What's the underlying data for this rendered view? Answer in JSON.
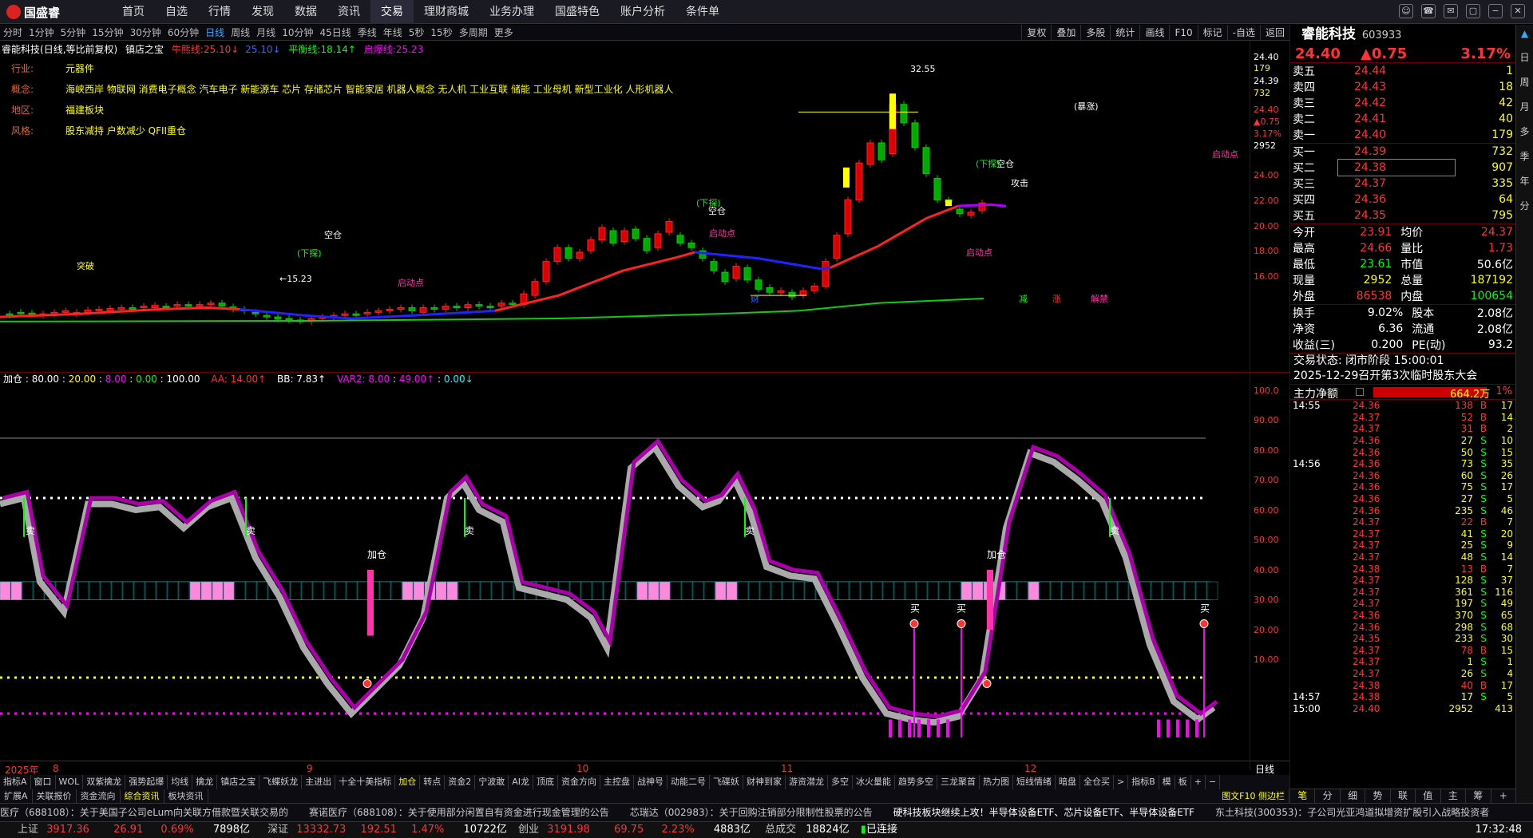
{
  "app": {
    "logo": "国盛睿"
  },
  "nav": [
    "首页",
    "自选",
    "行情",
    "发现",
    "数据",
    "资讯",
    "交易",
    "理财商城",
    "业务办理",
    "国盛特色",
    "账户分析",
    "条件单"
  ],
  "nav_active": 6,
  "window_buttons": [
    "☺",
    "☎",
    "✉",
    "▢",
    "−",
    "✕"
  ],
  "periods": [
    "分时",
    "1分钟",
    "5分钟",
    "15分钟",
    "30分钟",
    "60分钟",
    "日线",
    "周线",
    "月线",
    "10分钟",
    "45日线",
    "季线",
    "年线",
    "5秒",
    "15秒",
    "多周期",
    "更多"
  ],
  "period_active": 6,
  "tools": [
    "复权",
    "叠加",
    "多股",
    "统计",
    "画线",
    "F10",
    "标记",
    "-自选",
    "返回"
  ],
  "stock": {
    "name": "睿能科技",
    "mode": "(日线,等比前复权)",
    "indicator": "镇店之宝",
    "l1_label": "牛熊线:",
    "l1": "25.10",
    "l2": "25.10",
    "l3_label": "平衡线:",
    "l3": "18.14",
    "l4_label": "启爆线:",
    "l4": "25.23",
    "code": "603933"
  },
  "info": [
    {
      "k": "行业:",
      "v": "元器件"
    },
    {
      "k": "概念:",
      "v": "海峡西岸 物联网 消费电子概念 汽车电子 新能源车 芯片 存储芯片 智能家居 机器人概念 无人机 工业互联 储能 工业母机 新型工业化 人形机器人"
    },
    {
      "k": "地区:",
      "v": "福建板块"
    },
    {
      "k": "风格:",
      "v": "股东减持 户数减少 QFII重仓"
    }
  ],
  "price_scale": [
    "24.40",
    "179",
    "24.39",
    "732",
    "24.40",
    "▲0.75",
    "3.17%",
    "2952",
    "24.00",
    "22.00",
    "20.00",
    "18.00",
    "16.00"
  ],
  "ind_scale": [
    "100.0",
    "90.00",
    "80.00",
    "70.00",
    "60.00",
    "50.00",
    "40.00",
    "30.00",
    "20.00",
    "10.00"
  ],
  "ind_header": {
    "name": "加仓",
    "v1": "80.00",
    "v2": "20.00",
    "v3": "8.00",
    "v4": "0.00",
    "v5": "100.00",
    "aa": "AA: 14.00↑",
    "bb": "BB: 7.83↑",
    "var2": "VAR2: 8.00",
    "v6": "49.00↑",
    "v7": "0.00↓"
  },
  "dates": [
    "2025年",
    "8",
    "9",
    "10",
    "11",
    "12"
  ],
  "date_right": "日线",
  "chart_marks": {
    "high": "32.55",
    "low": "15.23",
    "kongcang1": "空仓",
    "kongcang2": "空仓",
    "kongcang3": "空仓",
    "xiati1": "(下探)",
    "xiati2": "(下探)",
    "xiati3": "(下探)",
    "qidong1": "启动点",
    "qidong2": "启动点",
    "qidong3": "启动点",
    "qidong4": "启动点",
    "tupo": "突破",
    "tuzhang": "(暴涨)",
    "jingong": "攻击",
    "cai": "财",
    "jian": "减",
    "zhang": "涨",
    "jiedong": "解禁",
    "jiacang1": "加仓",
    "jiacang2": "加仓",
    "mai1": "卖",
    "mai2": "卖",
    "mai3": "卖",
    "mai4": "卖",
    "mai5": "卖",
    "buy1": "买",
    "buy2": "买",
    "buy3": "买"
  },
  "tabs1": [
    "指标A",
    "窗口",
    "WOL",
    "双紫擒龙",
    "强势起爆",
    "均线",
    "擒龙",
    "镇店之宝",
    "飞蝶妖龙",
    "主进出",
    "十全十美指标",
    "加仓",
    "转点",
    "资金2",
    "宁波敢",
    "AI龙",
    "顶底",
    "资金方向",
    "主控盘",
    "战神号",
    "动能二号",
    "飞碟妖",
    "财神到家",
    "游资潜龙",
    "多空",
    "冰火量能",
    "趋势多空",
    "三龙聚首",
    "热力图",
    "短线情绪",
    "暗盘",
    "全仓买",
    ">",
    "指标B",
    "模",
    "板",
    "+",
    "−"
  ],
  "tabs1_active": 11,
  "tabs2": [
    "扩展A",
    "关联报价",
    "资金流向",
    "综合资讯",
    "板块资讯"
  ],
  "tabs2_active": 3,
  "tabs2_right": "图文F10 侧边栏",
  "news": [
    "医疗（688108）：关于美国子公司eLum向关联方借款暨关联交易的",
    "赛诺医疗（688108）：关于使用部分闲置自有资金进行现金管理的公告",
    "芯瑞达（002983）：关于回购注销部分限制性股票的公告",
    "硬科技板块继续上攻！半导体设备ETF、芯片设备ETF、半导体设备ETF",
    "东土科技(300353)：子公司光亚鸿道拟增资扩股引入战略投资者"
  ],
  "status": {
    "sh_label": "上证",
    "sh": "3917.36",
    "sh_chg": "26.91",
    "sh_pct": "0.69%",
    "sh_amt": "7898亿",
    "sz_label": "深证",
    "sz": "13332.73",
    "sz_chg": "192.51",
    "sz_pct": "1.47%",
    "sz_amt": "10722亿",
    "cy_label": "创业",
    "cy": "3191.98",
    "cy_chg": "69.75",
    "cy_pct": "2.23%",
    "cy_amt": "4883亿",
    "tot_label": "总成交",
    "tot": "18824亿",
    "conn": "已连接",
    "time": "17:32:48"
  },
  "quote": {
    "name": "睿能科技",
    "code": "603933",
    "price": "24.40",
    "chg": "▲0.75",
    "pct": "3.17%"
  },
  "sells": [
    {
      "l": "卖五",
      "p": "24.44",
      "v": "1"
    },
    {
      "l": "卖四",
      "p": "24.43",
      "v": "18"
    },
    {
      "l": "卖三",
      "p": "24.42",
      "v": "42"
    },
    {
      "l": "卖二",
      "p": "24.41",
      "v": "40"
    },
    {
      "l": "卖一",
      "p": "24.40",
      "v": "179"
    }
  ],
  "buys": [
    {
      "l": "买一",
      "p": "24.39",
      "v": "732"
    },
    {
      "l": "买二",
      "p": "24.38",
      "v": "907"
    },
    {
      "l": "买三",
      "p": "24.37",
      "v": "335"
    },
    {
      "l": "买四",
      "p": "24.36",
      "v": "64"
    },
    {
      "l": "买五",
      "p": "24.35",
      "v": "795"
    }
  ],
  "stats": [
    {
      "k1": "今开",
      "v1": "23.91",
      "k2": "均价",
      "v2": "24.37"
    },
    {
      "k1": "最高",
      "v1": "24.66",
      "k2": "量比",
      "v2": "1.73"
    },
    {
      "k1": "最低",
      "v1": "23.61",
      "k2": "市值",
      "v2": "50.6亿"
    },
    {
      "k1": "现量",
      "v1": "2952",
      "k2": "总量",
      "v2": "187192"
    },
    {
      "k1": "外盘",
      "v1": "86538",
      "k2": "内盘",
      "v2": "100654"
    }
  ],
  "stats2": [
    {
      "k1": "换手",
      "v1": "9.02%",
      "k2": "股本",
      "v2": "2.08亿"
    },
    {
      "k1": "净资",
      "v1": "6.36",
      "k2": "流通",
      "v2": "2.08亿"
    },
    {
      "k1": "收益(三)",
      "v1": "0.200",
      "k2": "PE(动)",
      "v2": "93.2"
    }
  ],
  "trade_state": "交易状态: 闭市阶段 15:00:01",
  "event": "2025-12-29召开第3次临时股东大会",
  "netflow": {
    "label": "主力净额",
    "value": "664.2万",
    "pct": "1%"
  },
  "ticks": [
    {
      "t": "14:55",
      "p": "24.36",
      "v": "138",
      "d": "B",
      "n": "17"
    },
    {
      "t": "",
      "p": "24.37",
      "v": "52",
      "d": "B",
      "n": "14"
    },
    {
      "t": "",
      "p": "24.37",
      "v": "31",
      "d": "B",
      "n": "2"
    },
    {
      "t": "",
      "p": "24.36",
      "v": "27",
      "d": "S",
      "n": "10"
    },
    {
      "t": "",
      "p": "24.36",
      "v": "50",
      "d": "S",
      "n": "15"
    },
    {
      "t": "14:56",
      "p": "24.36",
      "v": "73",
      "d": "S",
      "n": "35"
    },
    {
      "t": "",
      "p": "24.36",
      "v": "60",
      "d": "S",
      "n": "26"
    },
    {
      "t": "",
      "p": "24.36",
      "v": "75",
      "d": "S",
      "n": "17"
    },
    {
      "t": "",
      "p": "24.36",
      "v": "27",
      "d": "S",
      "n": "5"
    },
    {
      "t": "",
      "p": "24.36",
      "v": "235",
      "d": "S",
      "n": "46"
    },
    {
      "t": "",
      "p": "24.37",
      "v": "22",
      "d": "B",
      "n": "7"
    },
    {
      "t": "",
      "p": "24.37",
      "v": "41",
      "d": "S",
      "n": "20"
    },
    {
      "t": "",
      "p": "24.37",
      "v": "25",
      "d": "S",
      "n": "9"
    },
    {
      "t": "",
      "p": "24.37",
      "v": "48",
      "d": "S",
      "n": "14"
    },
    {
      "t": "",
      "p": "24.38",
      "v": "13",
      "d": "B",
      "n": "7"
    },
    {
      "t": "",
      "p": "24.37",
      "v": "128",
      "d": "S",
      "n": "37"
    },
    {
      "t": "",
      "p": "24.37",
      "v": "361",
      "d": "S",
      "n": "116"
    },
    {
      "t": "",
      "p": "24.37",
      "v": "197",
      "d": "S",
      "n": "49"
    },
    {
      "t": "",
      "p": "24.36",
      "v": "370",
      "d": "S",
      "n": "65"
    },
    {
      "t": "",
      "p": "24.36",
      "v": "298",
      "d": "S",
      "n": "68"
    },
    {
      "t": "",
      "p": "24.35",
      "v": "233",
      "d": "S",
      "n": "30"
    },
    {
      "t": "",
      "p": "24.37",
      "v": "78",
      "d": "B",
      "n": "15"
    },
    {
      "t": "",
      "p": "24.37",
      "v": "1",
      "d": "S",
      "n": "1"
    },
    {
      "t": "",
      "p": "24.37",
      "v": "26",
      "d": "S",
      "n": "4"
    },
    {
      "t": "",
      "p": "24.38",
      "v": "40",
      "d": "B",
      "n": "17"
    },
    {
      "t": "14:57",
      "p": "24.38",
      "v": "17",
      "d": "S",
      "n": "5"
    },
    {
      "t": "15:00",
      "p": "24.40",
      "v": "2952",
      "d": "",
      "n": "413"
    }
  ],
  "bottom_tabs": [
    "笔",
    "分",
    "细",
    "势",
    "联",
    "值",
    "主",
    "筹",
    "+"
  ],
  "side_bar": [
    "日",
    "周",
    "月",
    "多",
    "季",
    "年",
    "分"
  ]
}
